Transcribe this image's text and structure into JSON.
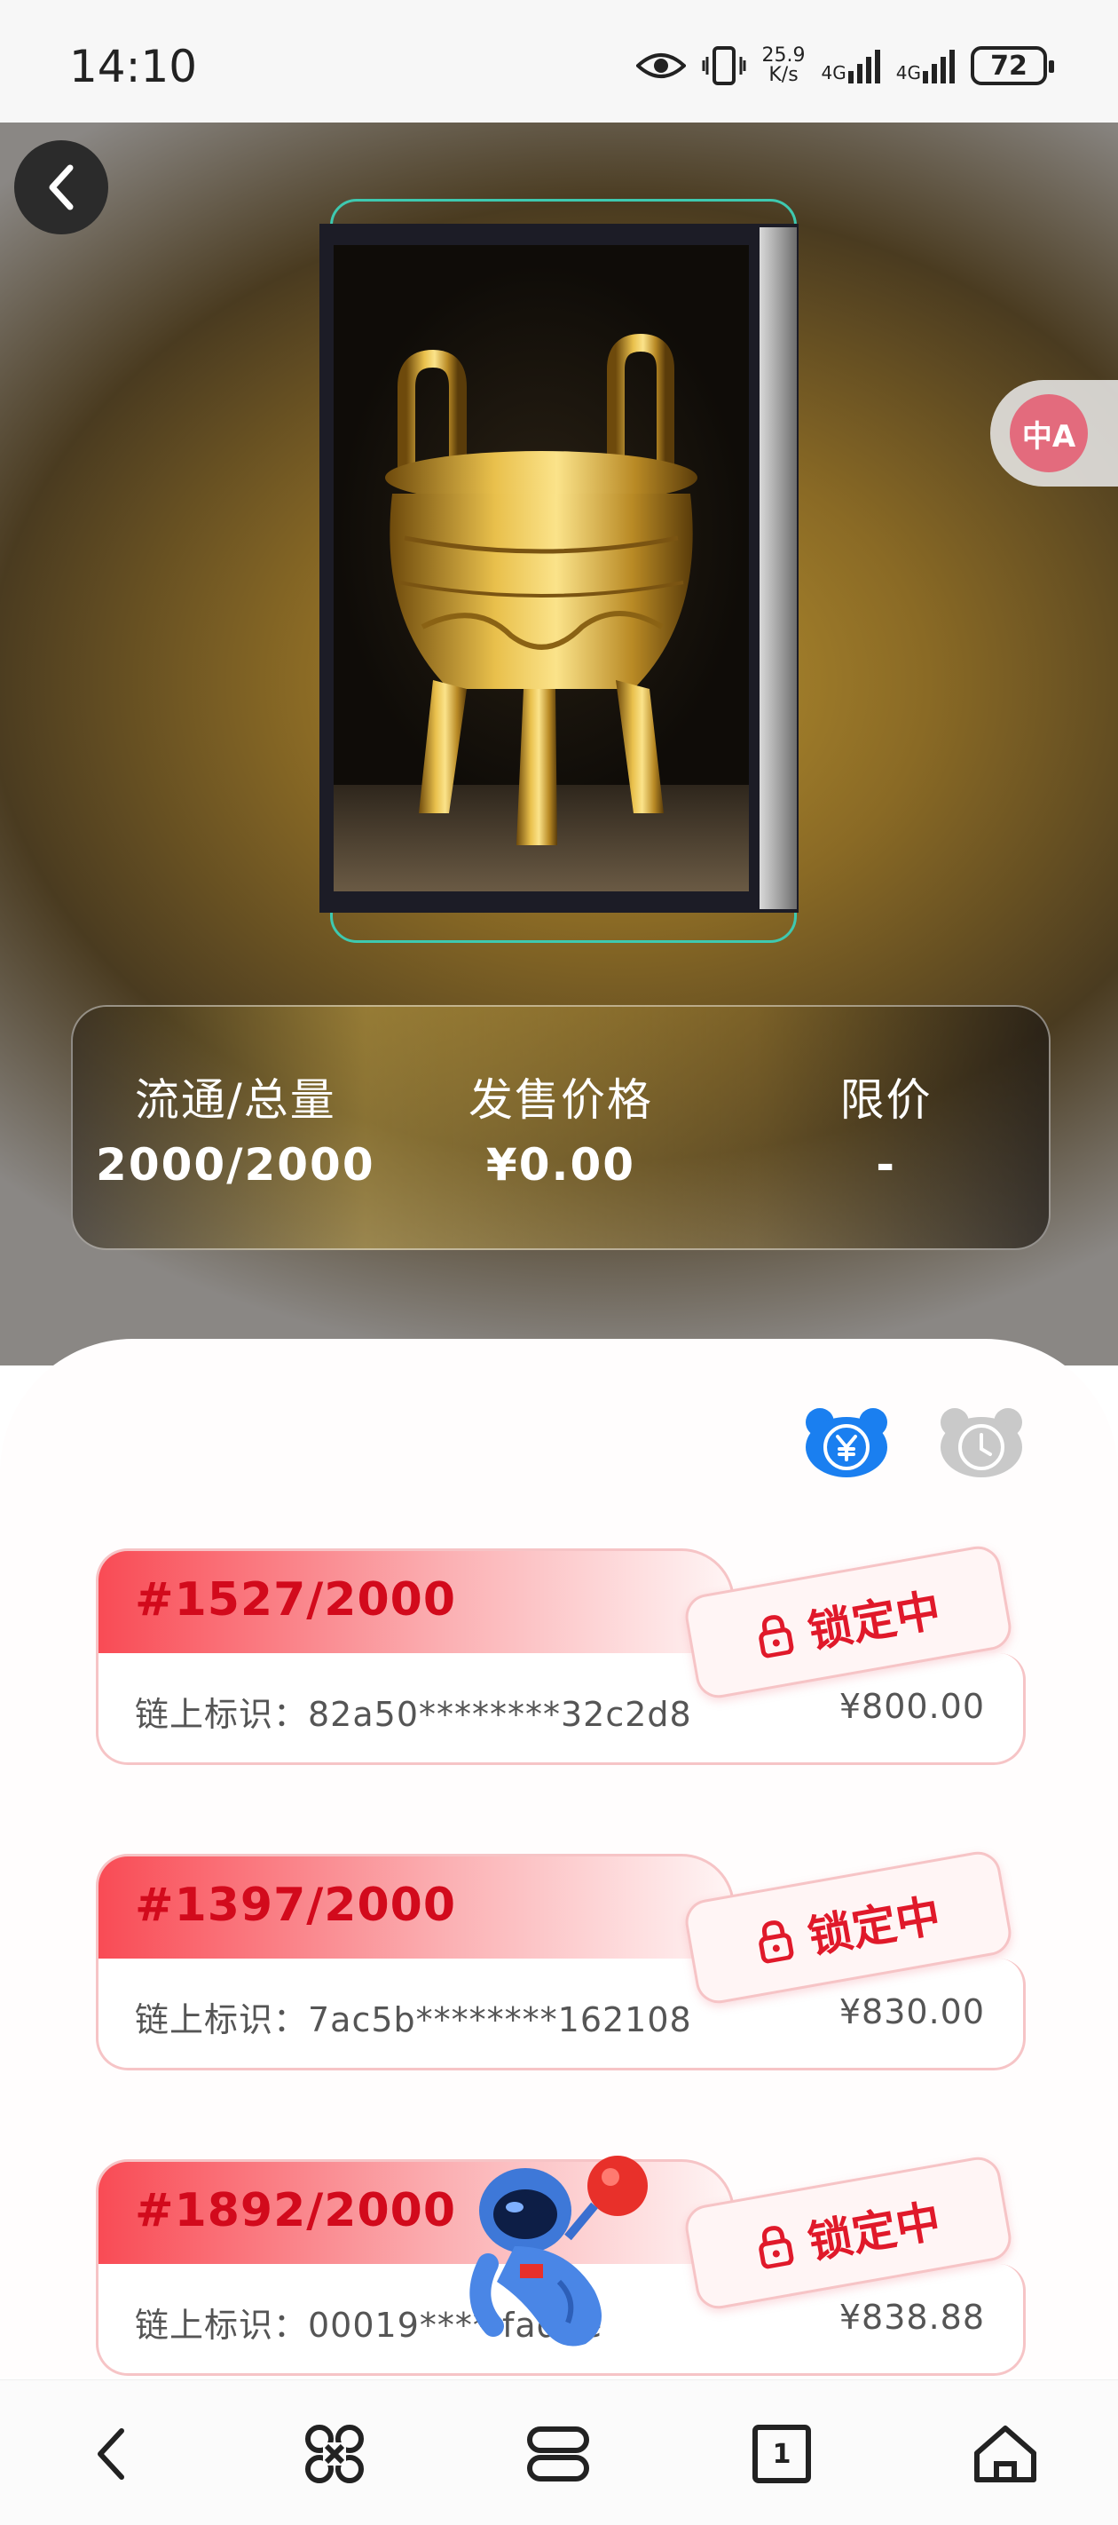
{
  "status_bar": {
    "time": "14:10",
    "net_speed_value": "25.9",
    "net_speed_unit": "K/s",
    "signal_1": "4G",
    "signal_2": "4G",
    "battery": "72"
  },
  "hero": {
    "back_icon": "chevron-left-icon",
    "translate_icon": "translate-icon",
    "translate_glyph": "中A"
  },
  "info": {
    "circulation_label": "流通/总量",
    "circulation_value": "2000/2000",
    "price_label": "发售价格",
    "price_value": "¥0.00",
    "limit_label": "限价",
    "limit_value": "-"
  },
  "sort": {
    "price_icon": "yen-bear-icon",
    "time_icon": "clock-bear-icon",
    "price_active_color": "#1a7ff0",
    "time_inactive_color": "#c9c9c9"
  },
  "listings": [
    {
      "number": "#1527/2000",
      "chain_id": "链上标识：82a50********32c2d8",
      "price": "¥800.00",
      "status": "锁定中"
    },
    {
      "number": "#1397/2000",
      "chain_id": "链上标识：7ac5b********162108",
      "price": "¥830.00",
      "status": "锁定中"
    },
    {
      "number": "#1892/2000",
      "chain_id": "链上标识：00019****     fad9e",
      "price": "¥838.88",
      "status": "锁定中"
    }
  ],
  "colors": {
    "accent_red": "#e0192a",
    "card_border": "#f6c4c6",
    "frame_teal": "#3ec9b0"
  },
  "nav": {
    "back_icon": "back-icon",
    "apps_icon": "apps-icon",
    "multitask_icon": "multitask-icon",
    "tabs_count": "1",
    "home_icon": "home-icon"
  }
}
